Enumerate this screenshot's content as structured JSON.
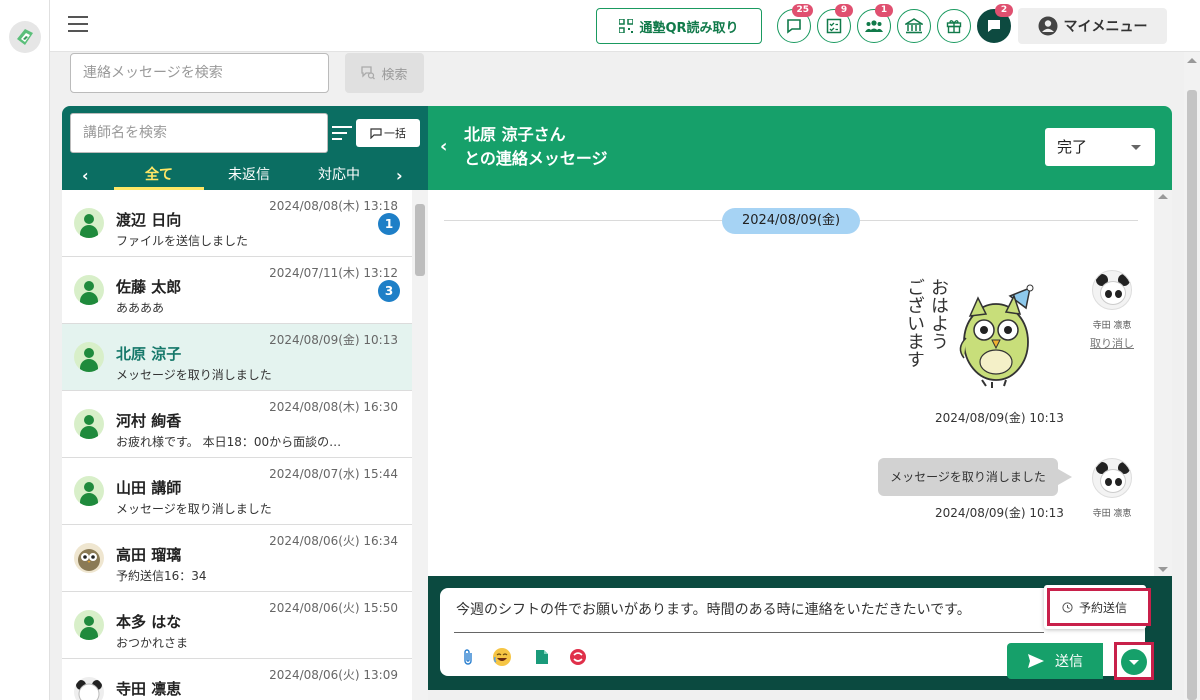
{
  "topbar": {
    "qr_label": "通塾QR読み取り",
    "badges": {
      "messages": "25",
      "tasks": "9",
      "students": "1",
      "school": "",
      "gift": "",
      "chat": "2"
    },
    "mymenu_label": "マイメニュー"
  },
  "message_search": {
    "placeholder": "連絡メッセージを検索",
    "button_label": "検索"
  },
  "contacts_panel": {
    "search_placeholder": "講師名を検索",
    "bulk_label": "一括",
    "tabs": [
      {
        "label": "全て",
        "active": true
      },
      {
        "label": "未返信",
        "active": false
      },
      {
        "label": "対応中",
        "active": false
      }
    ],
    "contacts": [
      {
        "name": "渡辺 日向",
        "time": "2024/08/08(木) 13:18",
        "preview": "ファイルを送信しました",
        "unread": "1"
      },
      {
        "name": "佐藤 太郎",
        "time": "2024/07/11(木) 13:12",
        "preview": "ああああ",
        "unread": "3"
      },
      {
        "name": "北原 涼子",
        "time": "2024/08/09(金) 10:13",
        "preview": "メッセージを取り消しました",
        "unread": ""
      },
      {
        "name": "河村 絢香",
        "time": "2024/08/08(木) 16:30",
        "preview": "お疲れ様です。 本日18：00から面談の…",
        "unread": ""
      },
      {
        "name": "山田 講師",
        "time": "2024/08/07(水) 15:44",
        "preview": "メッセージを取り消しました",
        "unread": ""
      },
      {
        "name": "高田 瑠璃",
        "time": "2024/08/06(火) 16:34",
        "preview": "予約送信16：34",
        "unread": ""
      },
      {
        "name": "本多 はな",
        "time": "2024/08/06(火) 15:50",
        "preview": "おつかれさま",
        "unread": ""
      },
      {
        "name": "寺田 凛恵",
        "time": "2024/08/06(火) 13:09",
        "preview": "",
        "unread": ""
      }
    ]
  },
  "chat": {
    "title_line1": "北原 涼子さん",
    "title_line2": "との連絡メッセージ",
    "status_value": "完了",
    "date_chip": "2024/08/09(金)",
    "sticker_text": [
      "おはよう",
      "ございます"
    ],
    "messages": [
      {
        "sender": "寺田 凛恵",
        "time": "2024/08/09(金) 10:13",
        "cancel_label": "取り消し"
      },
      {
        "sender": "寺田 凛恵",
        "text": "メッセージを取り消しました",
        "time": "2024/08/09(金) 10:13"
      }
    ],
    "compose_text": "今週のシフトの件でお願いがあります。時間のある時に連絡をいただきたいです。",
    "send_label": "送信",
    "scheduled_label": "予約送信"
  },
  "colors": {
    "brand_green": "#16a06a",
    "dark_teal": "#0b6e62",
    "compose_bg": "#0b4a40",
    "highlight": "#c8204a",
    "badge": "#e05070"
  }
}
